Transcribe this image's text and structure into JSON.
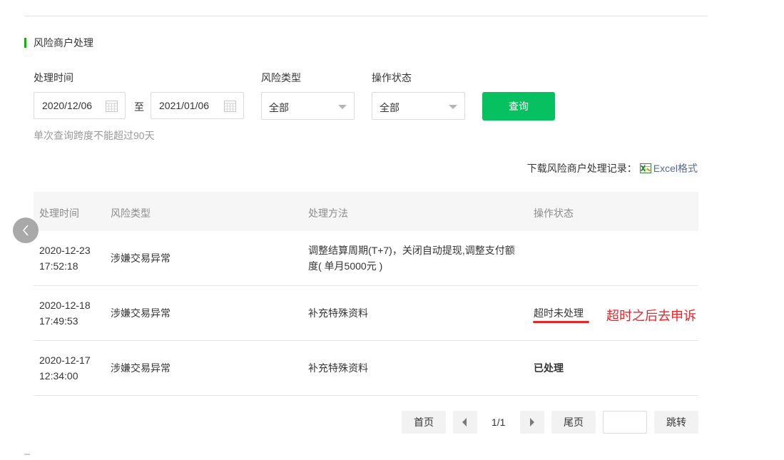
{
  "section": {
    "title": "风险商户处理"
  },
  "filters": {
    "time_label": "处理时间",
    "start_date": "2020/12/06",
    "to_text": "至",
    "end_date": "2021/01/06",
    "risk_type_label": "风险类型",
    "risk_type_value": "全部",
    "op_status_label": "操作状态",
    "op_status_value": "全部",
    "query_button": "查询",
    "hint": "单次查询跨度不能超过90天"
  },
  "download": {
    "label": "下载风险商户处理记录：",
    "link": "Excel格式"
  },
  "table": {
    "headers": [
      "处理时间",
      "风险类型",
      "处理方法",
      "操作状态"
    ],
    "rows": [
      {
        "date": "2020-12-23",
        "time": "17:52:18",
        "type": "涉嫌交易异常",
        "method": "调整结算周期(T+7)，关闭自动提现,调整支付额度( 单月5000元 )",
        "status": ""
      },
      {
        "date": "2020-12-18",
        "time": "17:49:53",
        "type": "涉嫌交易异常",
        "method": "补充特殊资料",
        "status": "超时未处理"
      },
      {
        "date": "2020-12-17",
        "time": "12:34:00",
        "type": "涉嫌交易异常",
        "method": "补充特殊资料",
        "status": "已处理"
      }
    ],
    "annotation": "超时之后去申诉"
  },
  "pager": {
    "first": "首页",
    "info": "1/1",
    "last": "尾页",
    "jump": "跳转"
  },
  "colors": {
    "accent": "#07c160",
    "warning": "#fa5151",
    "annotation": "#e8262a",
    "link": "#576b95"
  },
  "icons": [
    "calendar-icon",
    "dropdown-caret-icon",
    "excel-icon",
    "chevron-left-icon",
    "prev-page-icon",
    "next-page-icon"
  ]
}
